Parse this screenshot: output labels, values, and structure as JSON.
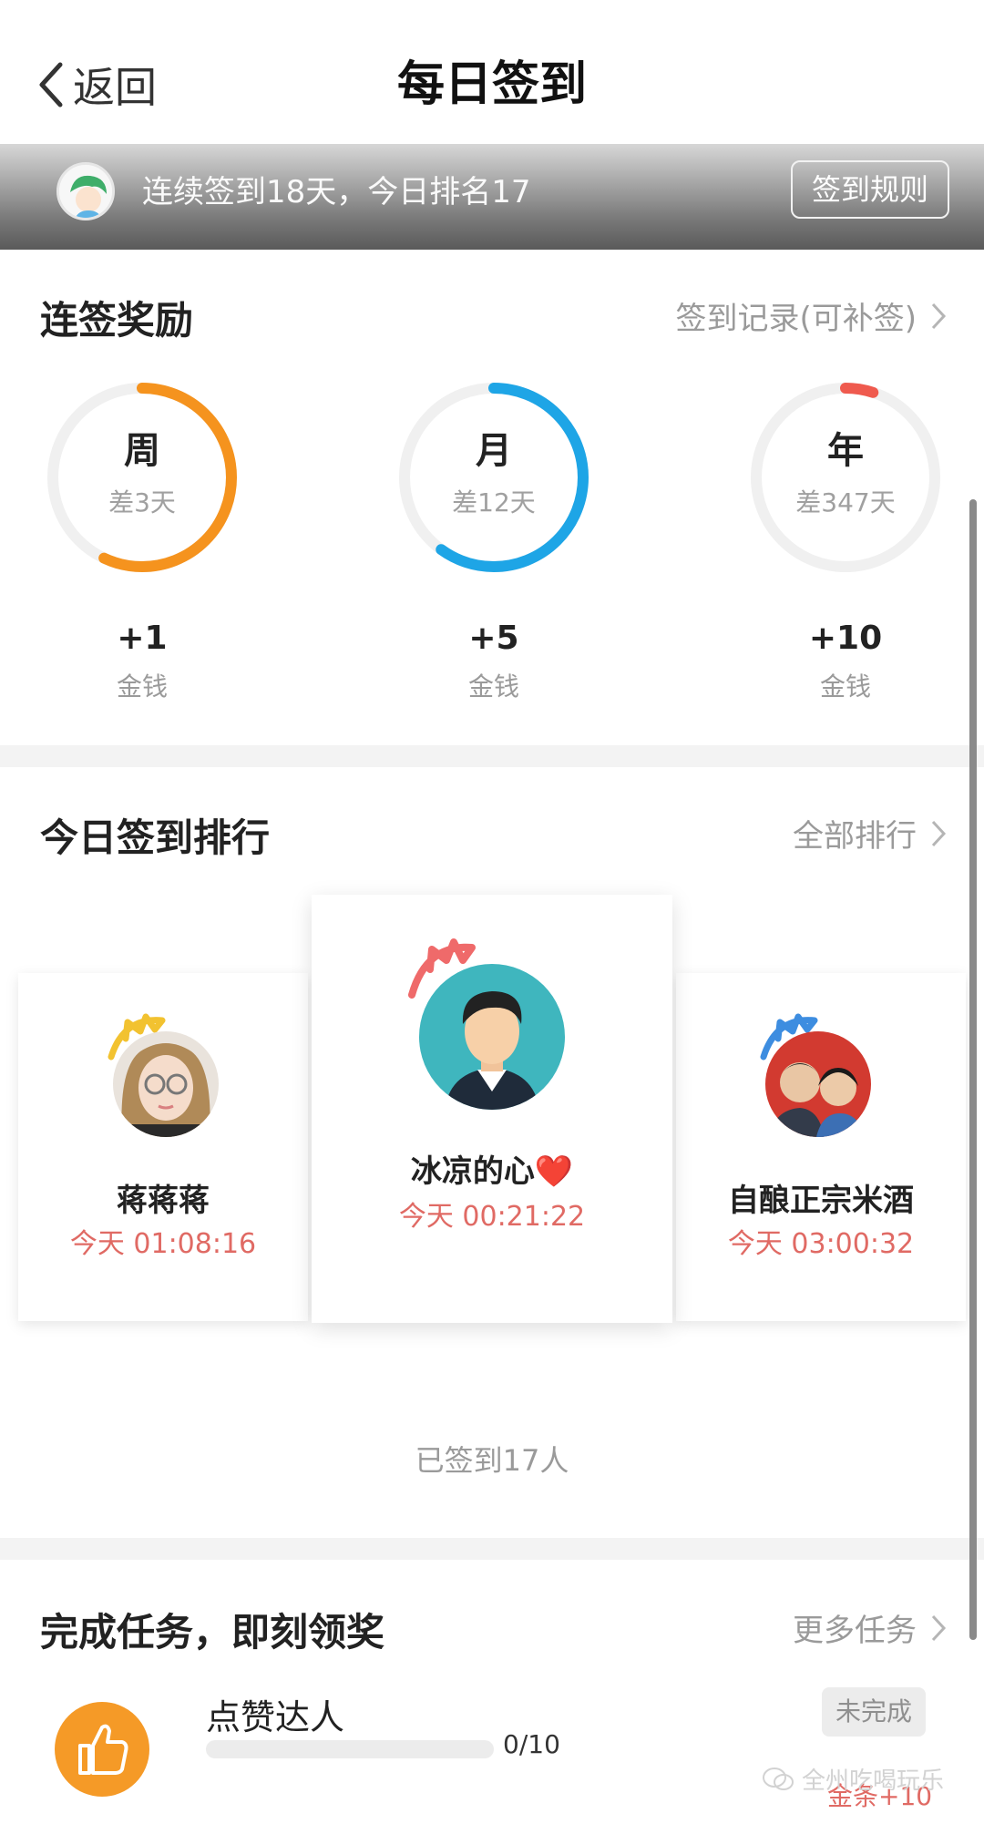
{
  "header": {
    "back_label": "返回",
    "title": "每日签到"
  },
  "banner": {
    "text": "连续签到18天，今日排名17",
    "rules_label": "签到规则"
  },
  "streak": {
    "title": "连签奖励",
    "link_label": "签到记录(可补签)",
    "rings": [
      {
        "label": "周",
        "sub": "差3天",
        "progress": 0.57,
        "color": "#f5931e",
        "reward": "+1",
        "unit": "金钱"
      },
      {
        "label": "月",
        "sub": "差12天",
        "progress": 0.6,
        "color": "#1ea5e6",
        "reward": "+5",
        "unit": "金钱"
      },
      {
        "label": "年",
        "sub": "差347天",
        "progress": 0.05,
        "color": "#ef5a4e",
        "reward": "+10",
        "unit": "金钱"
      }
    ]
  },
  "ranking": {
    "title": "今日签到排行",
    "link_label": "全部排行",
    "entries": [
      {
        "name": "蒋蒋蒋",
        "time": "今天 01:08:16",
        "crown_color": "#f2c230"
      },
      {
        "name": "冰凉的心❤️",
        "time": "今天 00:21:22",
        "crown_color": "#ef6a6a"
      },
      {
        "name": "自酿正宗米酒",
        "time": "今天 03:00:32",
        "crown_color": "#3d8de0"
      }
    ],
    "signed_count": "已签到17人"
  },
  "tasks": {
    "title": "完成任务，即刻领奖",
    "link_label": "更多任务",
    "items": [
      {
        "name": "点赞达人",
        "progress_text": "0/10",
        "progress": 0,
        "status": "未完成",
        "reward": "金条+10"
      }
    ]
  },
  "watermark": "全州吃喝玩乐"
}
